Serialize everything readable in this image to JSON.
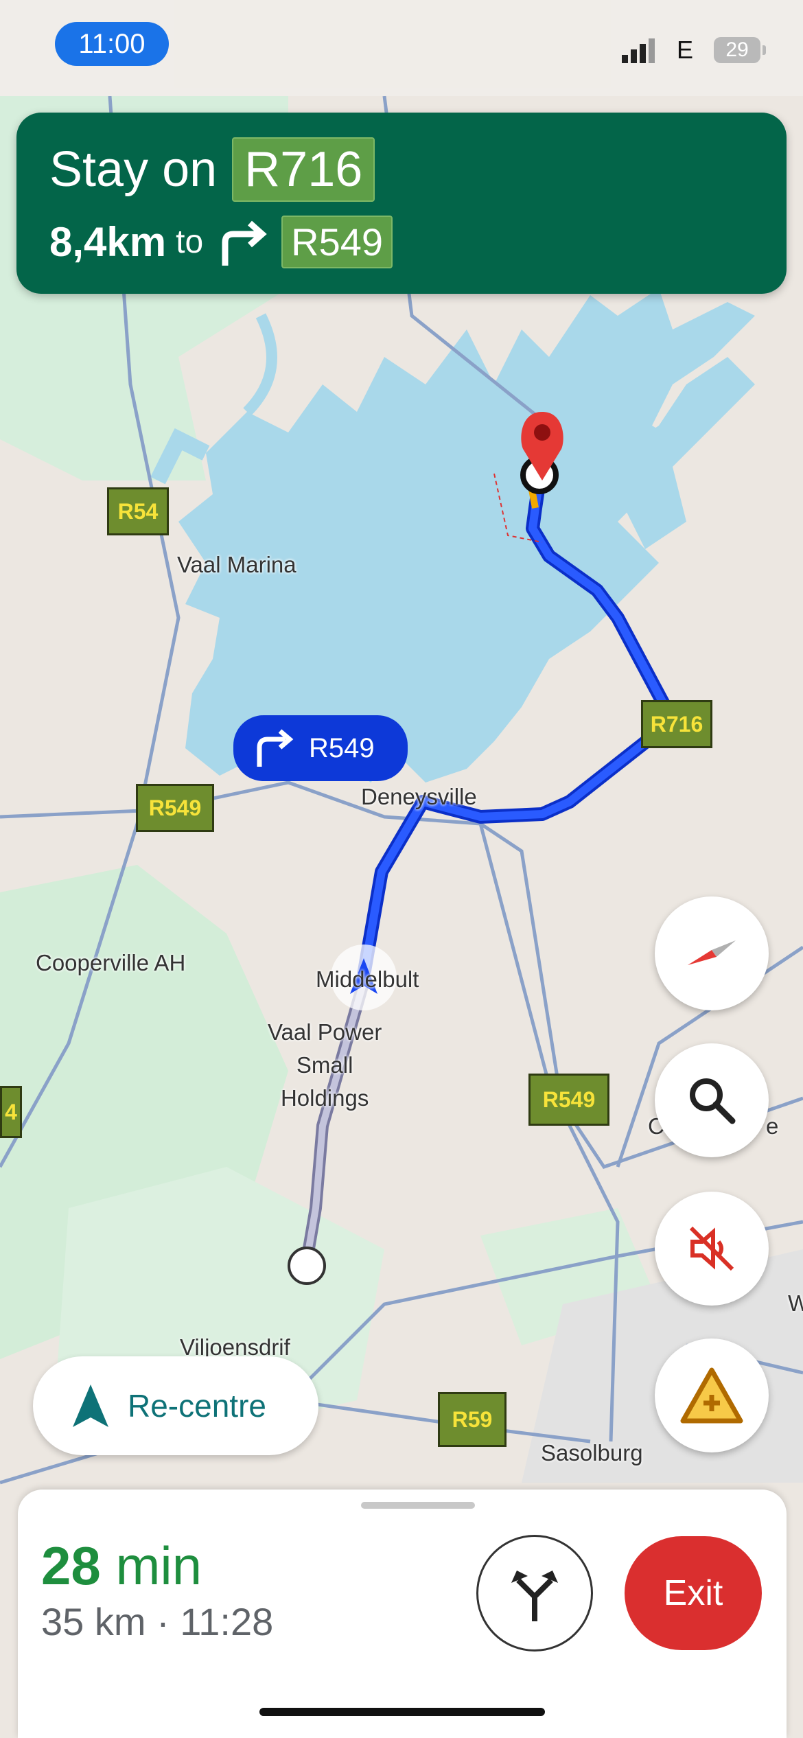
{
  "status_bar": {
    "time": "11:00",
    "network": "E",
    "battery": "29"
  },
  "nav_banner": {
    "instruction": "Stay on",
    "road": "R716",
    "next_distance": "8,4km",
    "to": "to",
    "next_road": "R549"
  },
  "map": {
    "labels": {
      "vaal_marina": "Vaal Marina",
      "deneysville": "Deneysville",
      "cooperville": "Cooperville AH",
      "middelbult": "Middelbult",
      "vaal_power_1": "Vaal Power",
      "vaal_power_2": "Small",
      "vaal_power_3": "Holdings",
      "viljoensdrif": "Viljoensdrif",
      "sasolburg": "Sasolburg",
      "edge_c": "C",
      "edge_e": "e",
      "edge_w": "W"
    },
    "shields": {
      "r54": "R54",
      "r549_left": "R549",
      "r716": "R716",
      "r549_right": "R549",
      "r59": "R59",
      "edge_4": "4"
    },
    "turn_callout": "R549"
  },
  "controls": {
    "recentre": "Re-centre"
  },
  "trip": {
    "duration_value": "28",
    "duration_unit": "min",
    "distance": "35 km",
    "separator": "·",
    "arrival": "11:28",
    "exit": "Exit"
  },
  "colors": {
    "banner": "#036549",
    "route": "#0F46F0",
    "exit": "#DA2F2F",
    "eta": "#1E8E3E"
  },
  "icons": [
    "compass-icon",
    "search-icon",
    "mute-icon",
    "report-incident-icon",
    "alternate-routes-icon",
    "navigation-arrow-icon",
    "turn-right-icon",
    "destination-pin-icon"
  ]
}
